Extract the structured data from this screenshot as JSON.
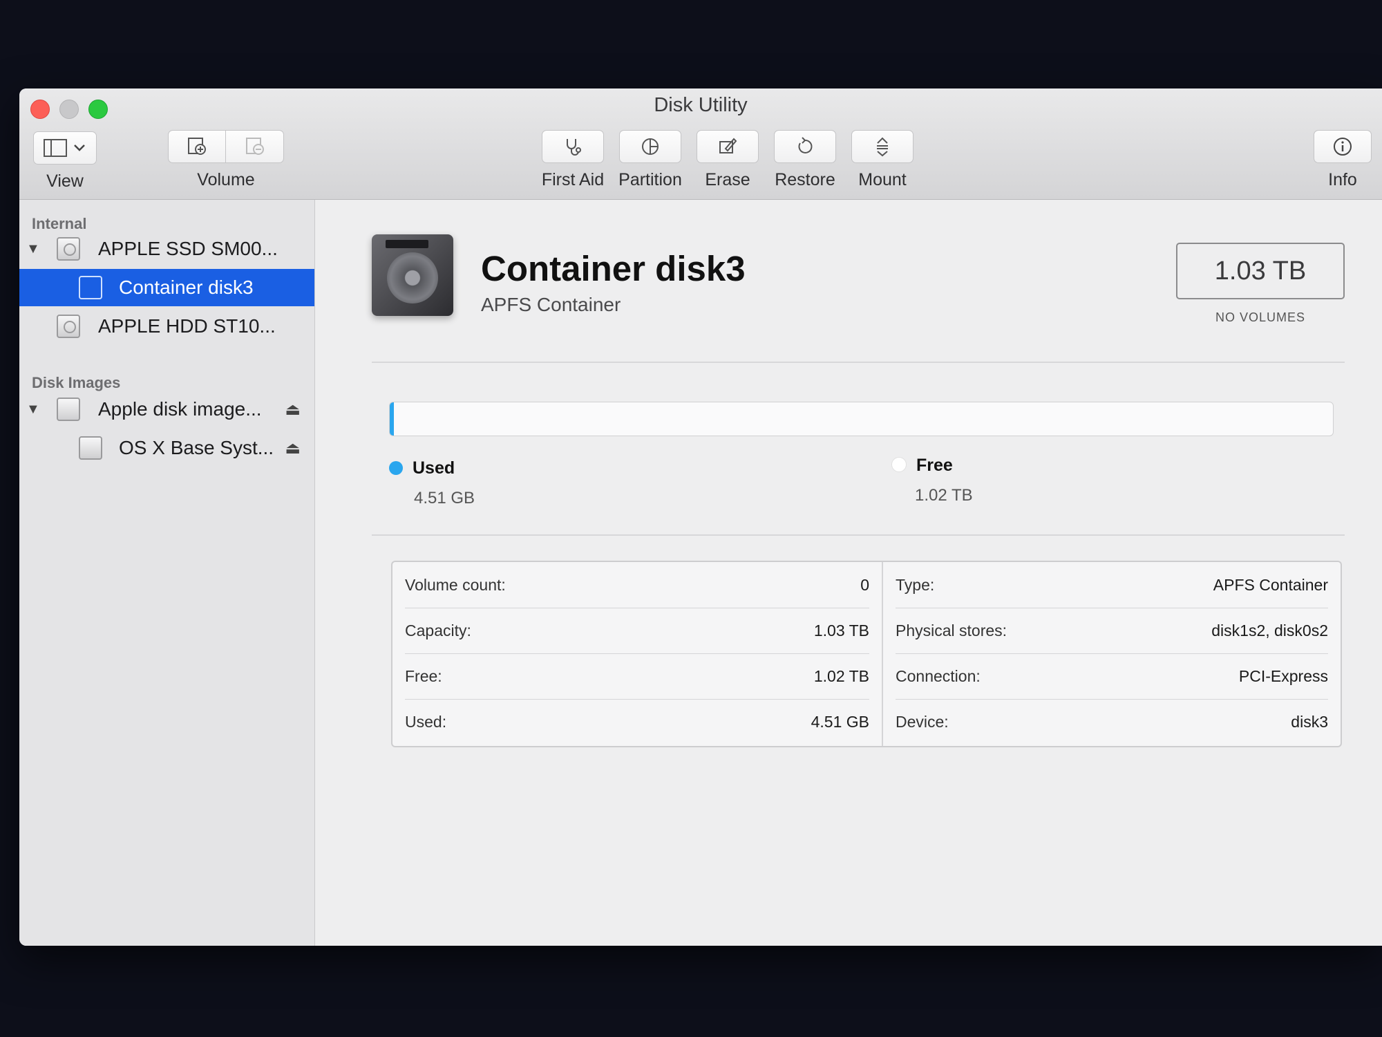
{
  "window": {
    "title": "Disk Utility"
  },
  "toolbar": {
    "view_label": "View",
    "volume_label": "Volume",
    "first_aid_label": "First Aid",
    "partition_label": "Partition",
    "erase_label": "Erase",
    "restore_label": "Restore",
    "mount_label": "Mount",
    "info_label": "Info"
  },
  "sidebar": {
    "internal_header": "Internal",
    "disk_images_header": "Disk Images",
    "items": [
      {
        "label": "APPLE SSD SM00...",
        "icon": "hard-disk-icon"
      },
      {
        "label": "Container disk3",
        "icon": "container-icon",
        "selected": true
      },
      {
        "label": "APPLE HDD ST10...",
        "icon": "hard-disk-icon"
      },
      {
        "label": "Apple disk image...",
        "icon": "disk-image-icon"
      },
      {
        "label": "OS X Base Syst...",
        "icon": "volume-icon"
      }
    ]
  },
  "main": {
    "title": "Container disk3",
    "subtitle": "APFS Container",
    "capacity_display": "1.03 TB",
    "capacity_note": "NO VOLUMES",
    "usage": {
      "used_fraction": 0.0044,
      "used_label": "Used",
      "used_value": "4.51 GB",
      "used_color": "#2aa6ee",
      "free_label": "Free",
      "free_value": "1.02 TB",
      "free_color": "#ffffff"
    },
    "info_left": [
      {
        "label": "Volume count:",
        "value": "0"
      },
      {
        "label": "Capacity:",
        "value": "1.03 TB"
      },
      {
        "label": "Free:",
        "value": "1.02 TB"
      },
      {
        "label": "Used:",
        "value": "4.51 GB"
      }
    ],
    "info_right": [
      {
        "label": "Type:",
        "value": "APFS Container"
      },
      {
        "label": "Physical stores:",
        "value": "disk1s2, disk0s2"
      },
      {
        "label": "Connection:",
        "value": "PCI-Express"
      },
      {
        "label": "Device:",
        "value": "disk3"
      }
    ]
  }
}
